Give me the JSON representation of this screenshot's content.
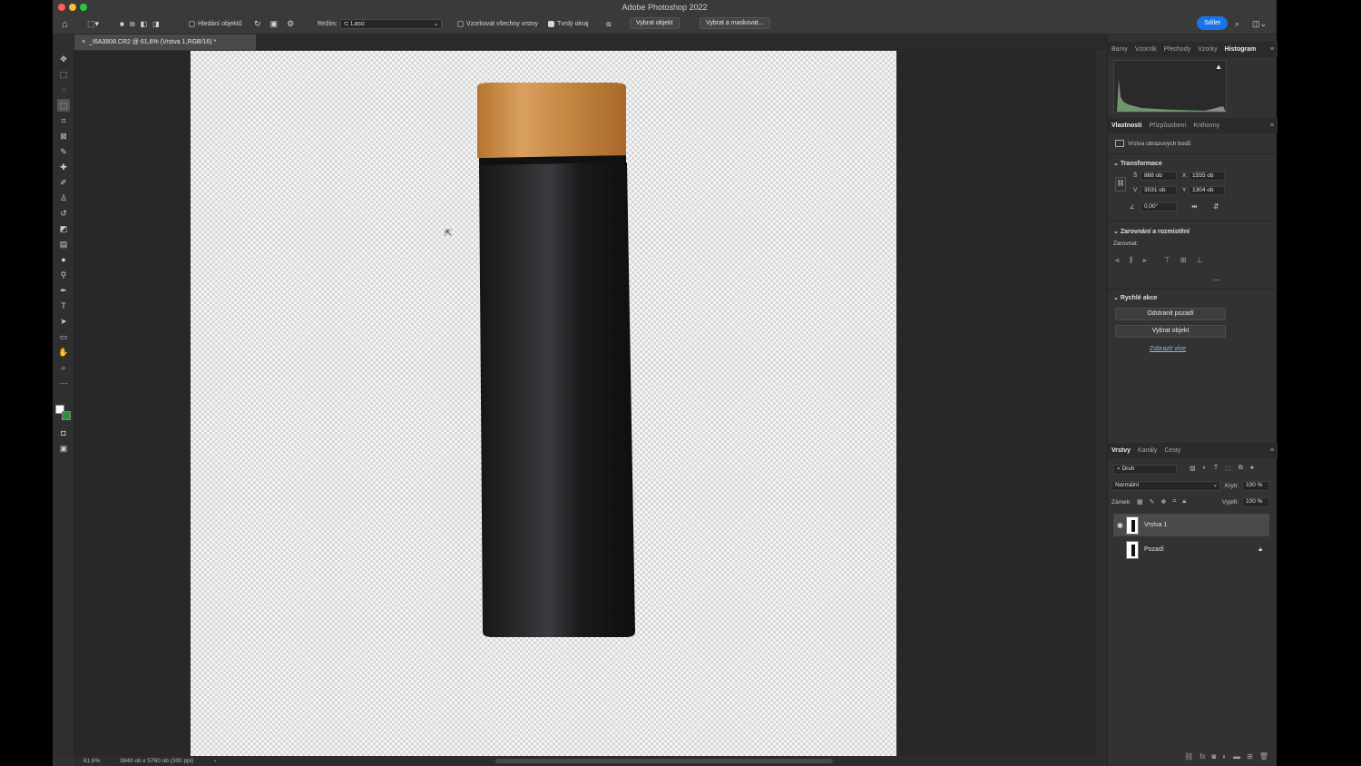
{
  "app": {
    "title": "Adobe Photoshop 2022"
  },
  "optionsbar": {
    "find_objects": "Hledání objektů",
    "mode_label": "Režim:",
    "mode_value": "Laso",
    "sample_all": "Vzorkovat všechny vrstvy",
    "hard_edge": "Tvrdý okraj",
    "select_subject": "Vybrat objekt",
    "select_mask": "Vybrat a maskovat...",
    "share": "Sdílet"
  },
  "document": {
    "tab": "_I6A3808.CR2 @ 61,6% (Vrstva 1,RGB/16) *"
  },
  "status": {
    "zoom": "61,6%",
    "size": "3840 ob x 5760 ob (300 ppi)",
    "arrow": "›"
  },
  "panels": {
    "top_tabs": [
      "Barvy",
      "Vzorník",
      "Přechody",
      "Vzorky",
      "Histogram"
    ],
    "prop_tabs": [
      "Vlastnosti",
      "Přizpůsobení",
      "Knihovny"
    ],
    "layer_type": "Vrstva obrazových bodů",
    "transform": {
      "title": "Transformace",
      "w_label": "Š",
      "w": "868 ob",
      "h_label": "V",
      "h": "3031 ob",
      "x_label": "X",
      "x": "1555 ob",
      "y_label": "Y",
      "y": "1304 ob",
      "angle": "0,00°"
    },
    "align": {
      "title": "Zarovnání a rozmístění",
      "label": "Zarovnat:",
      "more": "..."
    },
    "quick": {
      "title": "Rychlé akce",
      "remove_bg": "Odstranit pozadí",
      "select_subject": "Vybrat objekt",
      "show_more": "Zobrazit více"
    },
    "layer_tabs": [
      "Vrstvy",
      "Kanály",
      "Cesty"
    ],
    "filter_kind": "Druh",
    "blend": "Normální",
    "opacity_label": "Krytí:",
    "opacity": "100 %",
    "lock_label": "Zámek:",
    "fill_label": "Výplň:",
    "fill": "100 %",
    "layers": [
      {
        "name": "Vrstva 1"
      },
      {
        "name": "Pozadí"
      }
    ]
  }
}
